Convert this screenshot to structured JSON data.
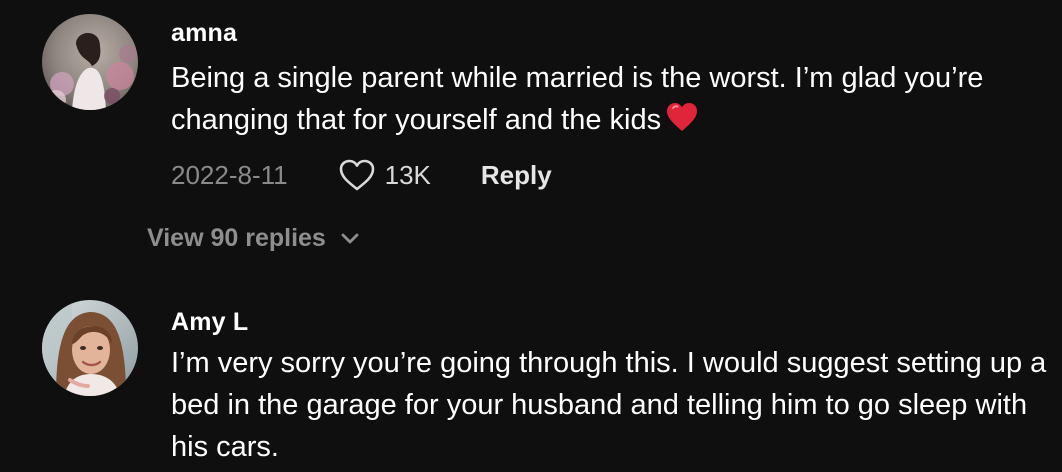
{
  "comments": [
    {
      "username": "amna",
      "text": "Being a single parent while married is the worst. I’m glad you’re changing that for yourself and the kids",
      "emoji": "red-heart-emoji",
      "date": "2022-8-11",
      "likes": "13K",
      "reply_label": "Reply",
      "view_replies_label": "View 90 replies",
      "icons": [
        "heart-outline-icon",
        "chevron-down-icon"
      ]
    },
    {
      "username": "Amy L",
      "text": "I’m very sorry you’re going through this. I would suggest setting up a bed in the garage for your husband and telling him to go sleep with his cars."
    }
  ],
  "colors": {
    "background": "#0f0f0f",
    "text": "#ffffff",
    "secondary_text": "#8a8a8a",
    "heart_emoji": "#e0243a"
  }
}
